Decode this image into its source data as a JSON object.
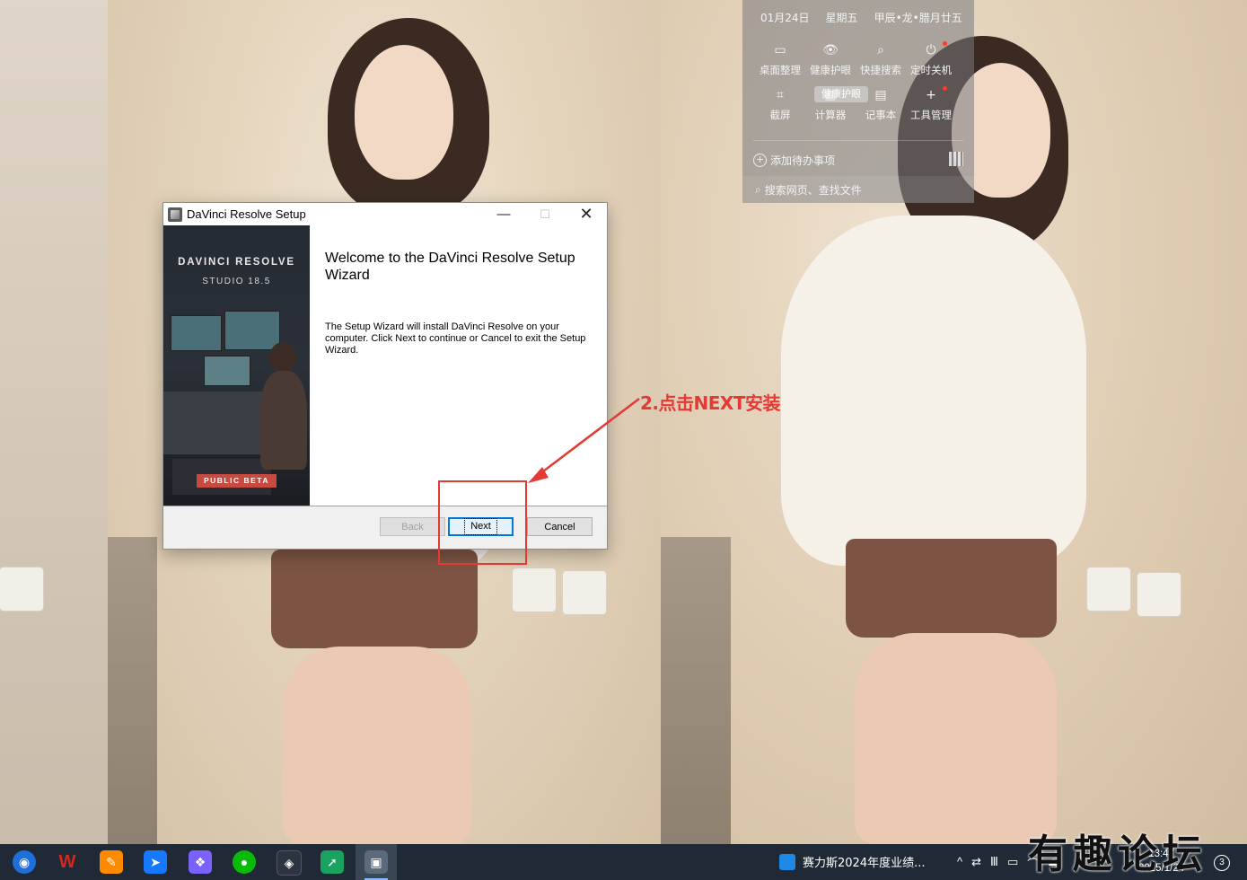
{
  "dialog": {
    "title": "DaVinci Resolve Setup",
    "win_min": "—",
    "win_max": "☐",
    "win_close": "✕",
    "brand_line1": "DAVINCI RESOLVE",
    "brand_line2": "STUDIO 18.5",
    "badge": "PUBLIC BETA",
    "welcome": "Welcome to the DaVinci Resolve Setup Wizard",
    "description": "The Setup Wizard will install DaVinci Resolve on your computer. Click Next to continue or Cancel to exit the Setup Wizard.",
    "buttons": {
      "back": "Back",
      "next": "Next",
      "cancel": "Cancel"
    }
  },
  "annotation": {
    "text": "2.点击NEXT安装",
    "color": "#e53935"
  },
  "widget": {
    "date": "01月24日",
    "weekday": "星期五",
    "lunar": "甲辰•龙•腊月廿五",
    "items": [
      {
        "label": "桌面整理",
        "icon": "▭"
      },
      {
        "label": "健康护眼",
        "icon": "👁"
      },
      {
        "label": "快捷搜索",
        "icon": "⌕"
      },
      {
        "label": "定时关机",
        "icon": "⏻"
      },
      {
        "label": "截屏",
        "icon": "⌗"
      },
      {
        "label": "计算器",
        "icon": "▦"
      },
      {
        "label": "记事本",
        "icon": "▤"
      },
      {
        "label": "工具管理",
        "icon": "+"
      }
    ],
    "tooltip": "健康护眼",
    "todo": "添加待办事项",
    "todo_plus": "+",
    "search_icon": "⌕",
    "search_placeholder": "搜索网页、查找文件"
  },
  "taskbar": {
    "task_label": "赛力斯2024年度业绩...",
    "tray_icons": [
      "^",
      "⇄",
      "Ⅲ",
      "▭",
      "⌒",
      "⏏"
    ],
    "time": "13:47",
    "date": "2025/1/24",
    "notification_count": "3",
    "icons": [
      {
        "name": "browser-icon",
        "glyph": "◉",
        "color": "#1e6fd9"
      },
      {
        "name": "wps-icon",
        "glyph": "W",
        "color": "#d7261e"
      },
      {
        "name": "app-icon-3",
        "glyph": "✎",
        "color": "#ff8a00"
      },
      {
        "name": "feishu-icon",
        "glyph": "➤",
        "color": "#1677ff"
      },
      {
        "name": "app-store-icon",
        "glyph": "❖",
        "color": "#7b61ff"
      },
      {
        "name": "wechat-icon",
        "glyph": "●",
        "color": "#09bb07"
      },
      {
        "name": "davinci-icon",
        "glyph": "◈",
        "color": "#2c3440"
      },
      {
        "name": "app-icon-8",
        "glyph": "➚",
        "color": "#1aa260"
      },
      {
        "name": "setup-icon",
        "glyph": "▣",
        "color": "#5b6b7b"
      }
    ]
  },
  "watermark": "有趣论坛"
}
